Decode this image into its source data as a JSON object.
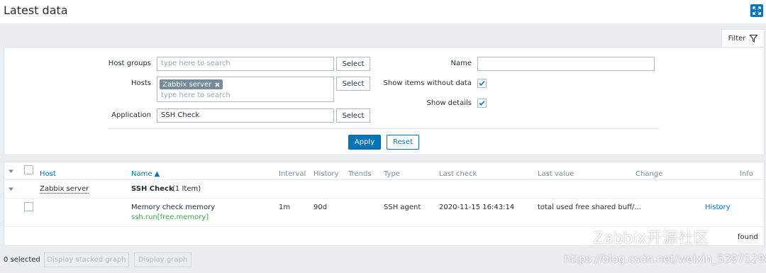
{
  "page": {
    "title": "Latest data"
  },
  "filter": {
    "tab_label": "Filter",
    "host_groups": {
      "label": "Host groups",
      "placeholder": "type here to search",
      "select_label": "Select"
    },
    "hosts": {
      "label": "Hosts",
      "selected": [
        "Zabbix server"
      ],
      "placeholder": "type here to search",
      "select_label": "Select"
    },
    "application": {
      "label": "Application",
      "value": "SSH Check",
      "select_label": "Select"
    },
    "name": {
      "label": "Name",
      "value": ""
    },
    "show_items_without_data": {
      "label": "Show items without data",
      "checked": true
    },
    "show_details": {
      "label": "Show details",
      "checked": true
    },
    "apply_label": "Apply",
    "reset_label": "Reset"
  },
  "table": {
    "headers": {
      "host": "Host",
      "name": "Name ▲",
      "interval": "Interval",
      "history": "History",
      "trends": "Trends",
      "type": "Type",
      "last_check": "Last check",
      "last_value": "Last value",
      "change": "Change",
      "info": "Info"
    },
    "groups": [
      {
        "host": "Zabbix server",
        "application": "SSH Check",
        "count": "(1 Item)",
        "items": [
          {
            "name": "Memory check memory",
            "key": "ssh.run[free.memory]",
            "interval": "1m",
            "history": "90d",
            "trends": "",
            "type": "SSH agent",
            "last_check": "2020-11-15 16:43:14",
            "last_value": "total used free shared buff/...",
            "change": "",
            "action": "History"
          }
        ]
      }
    ],
    "found_text": "found"
  },
  "footer": {
    "selected_text": "0 selected",
    "stacked_graph_label": "Display stacked graph",
    "graph_label": "Display graph"
  },
  "watermark": {
    "text": "Zabbix开源社区",
    "url": "https://blog.csdn.net/weixin_53971298"
  },
  "colors": {
    "accent": "#0275b8",
    "green": "#429e47",
    "tag": "#768d99",
    "background": "#ebeef0"
  }
}
